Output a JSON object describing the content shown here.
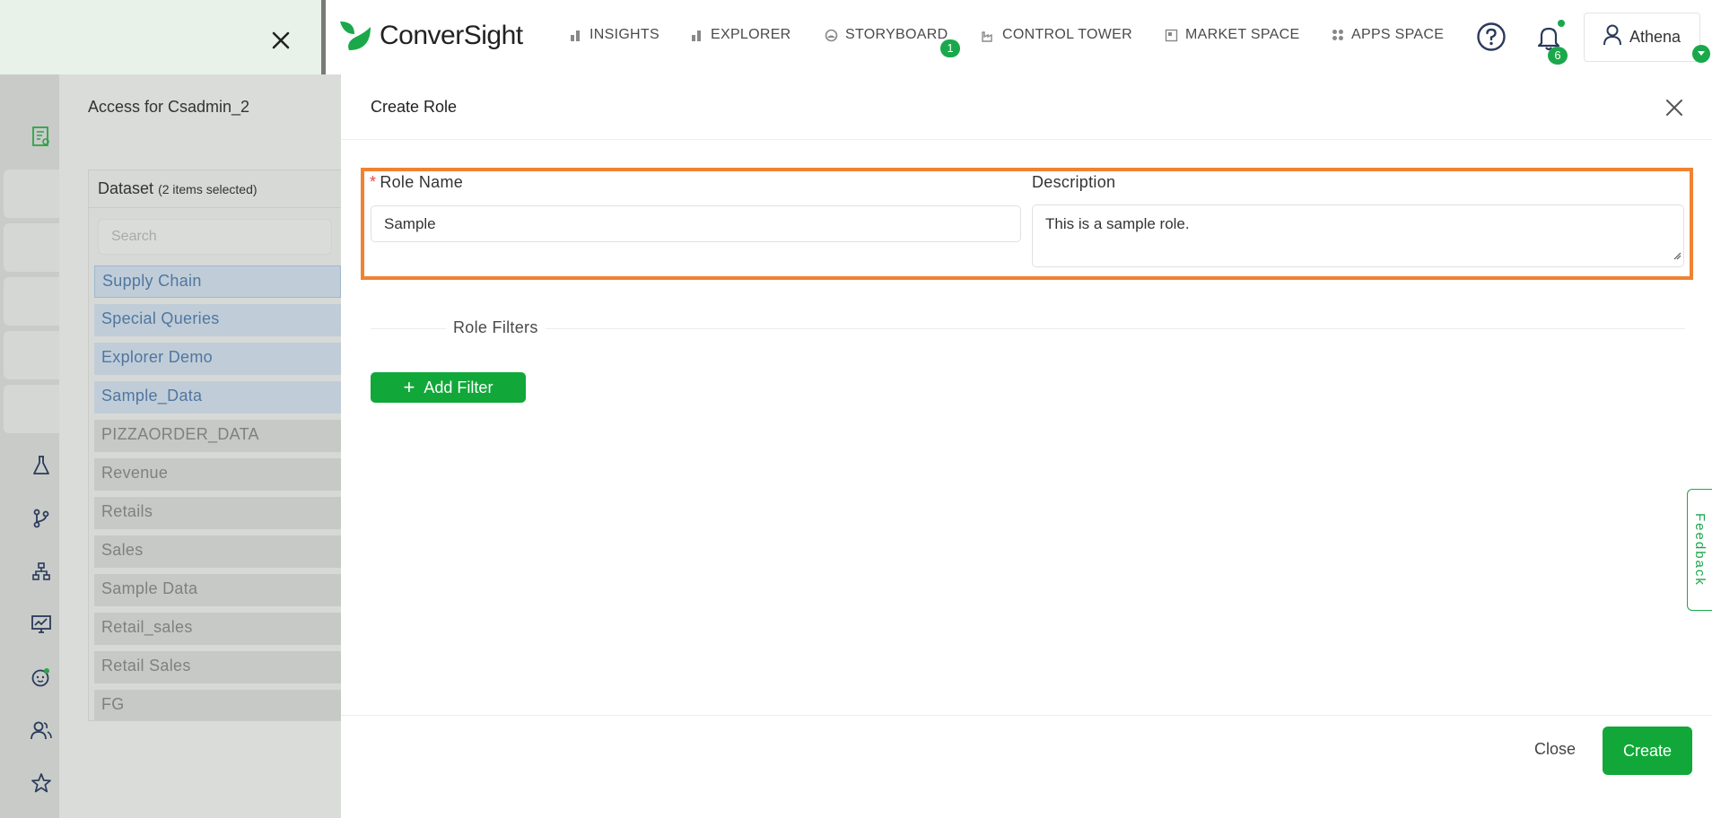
{
  "header": {
    "brand": "ConverSight",
    "nav": [
      {
        "label": "INSIGHTS",
        "icon": "bar-chart-icon"
      },
      {
        "label": "EXPLORER",
        "icon": "bar-chart-icon"
      },
      {
        "label": "STORYBOARD",
        "icon": "palette-icon",
        "badge": "1"
      },
      {
        "label": "CONTROL TOWER",
        "icon": "factory-icon"
      },
      {
        "label": "MARKET SPACE",
        "icon": "store-icon"
      },
      {
        "label": "APPS SPACE",
        "icon": "grid-icon"
      }
    ],
    "notifications_badge": "6",
    "user_name": "Athena"
  },
  "background": {
    "access_title": "Access for Csadmin_2",
    "dataset_title": "Dataset",
    "dataset_selected": "(2 items selected)",
    "search_placeholder": "Search",
    "datasets_selected": [
      "Supply Chain",
      "Special Queries",
      "Explorer Demo",
      "Sample_Data"
    ],
    "datasets_other": [
      "PIZZAORDER_DATA",
      "Revenue",
      "Retails",
      "Sales",
      "Sample Data",
      "Retail_sales",
      "Retail Sales",
      "FG"
    ]
  },
  "modal": {
    "title": "Create Role",
    "role_name_label": "Role Name",
    "required_mark": "*",
    "role_name_value": "Sample",
    "description_label": "Description",
    "description_value": "This is a sample role.",
    "role_filters_label": "Role Filters",
    "add_filter_label": "Add Filter",
    "close_label": "Close",
    "create_label": "Create"
  },
  "feedback_label": "Feedback",
  "colors": {
    "accent_green": "#11a839",
    "highlight_orange": "#f08232",
    "selected_blue": "#5076a0"
  }
}
